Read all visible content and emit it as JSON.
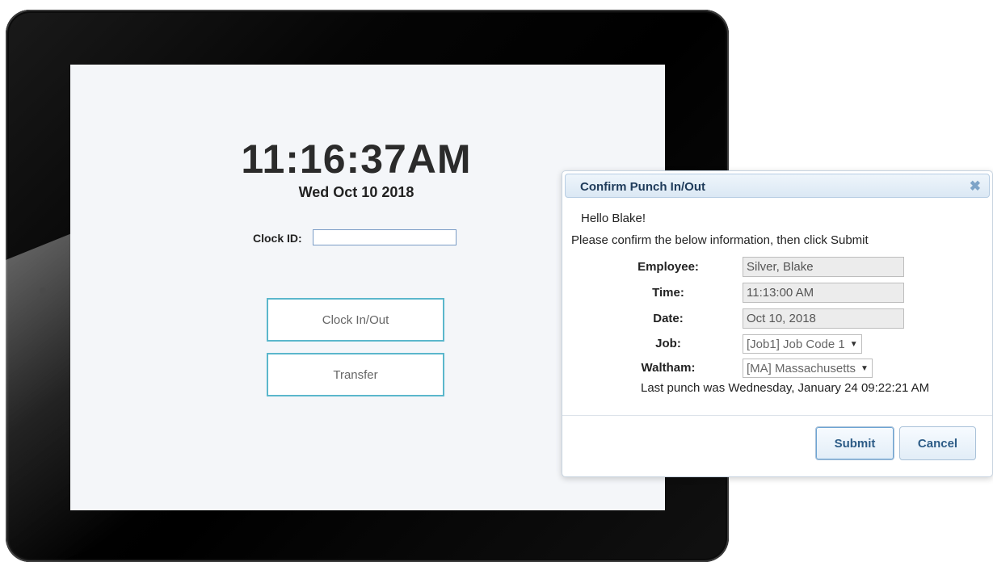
{
  "kiosk": {
    "time": "11:16:37AM",
    "date": "Wed Oct 10 2018",
    "clock_id_label": "Clock ID:",
    "clock_id_value": "",
    "clock_in_out_label": "Clock In/Out",
    "transfer_label": "Transfer"
  },
  "dialog": {
    "title": "Confirm Punch In/Out",
    "close_glyph": "✖",
    "greeting": "Hello Blake!",
    "instructions": "Please confirm the below information, then click Submit",
    "rows": [
      {
        "label": "Employee:",
        "value": "Silver, Blake"
      },
      {
        "label": "Time:",
        "value": "11:13:00 AM"
      },
      {
        "label": "Date:",
        "value": "Oct 10, 2018"
      }
    ],
    "job": {
      "label": "Job:",
      "value": "[Job1] Job Code 1"
    },
    "location": {
      "label": "Waltham:",
      "value": "[MA] Massachusetts"
    },
    "last_punch": "Last punch was Wednesday, January 24 09:22:21 AM",
    "submit_label": "Submit",
    "cancel_label": "Cancel"
  },
  "colors": {
    "accent_button_border": "#5bb7cc",
    "dialog_title": "#1f3b5a",
    "button_text": "#2d5c87"
  }
}
